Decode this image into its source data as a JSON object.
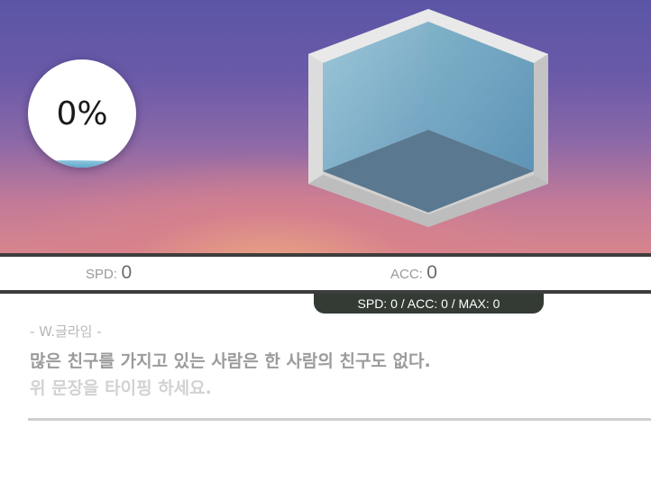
{
  "progress": {
    "percent_label": "0%",
    "value": 0
  },
  "stats": {
    "spd_label": "SPD:",
    "spd_value": "0",
    "acc_label": "ACC:",
    "acc_value": "0"
  },
  "summary": "SPD: 0 / ACC: 0 / MAX: 0",
  "quote": {
    "author": "- W.글라임 -",
    "sentence": "많은 친구를 가지고 있는 사람은 한 사람의 친구도 없다."
  },
  "input": {
    "value": "",
    "placeholder": "위 문장을 타이핑 하세요."
  },
  "colors": {
    "cube_frame": "#e3e3e3",
    "cube_wall_left": "#8fbdd3",
    "cube_wall_right": "#6fa4c2",
    "cube_floor": "#5a7a92",
    "dark_bar": "#3d3d3d",
    "summary_pill": "#333b34"
  }
}
